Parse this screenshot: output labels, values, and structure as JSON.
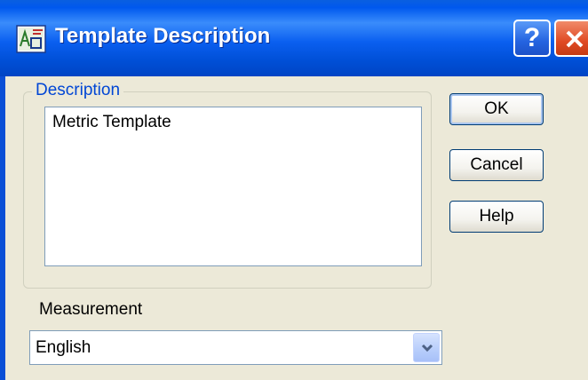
{
  "window": {
    "title": "Template Description",
    "icon": "template-app-icon",
    "help_icon": "question-mark-icon",
    "close_icon": "close-x-icon",
    "help_glyph": "?"
  },
  "description": {
    "group_label": "Description",
    "text": "Metric Template"
  },
  "buttons": {
    "ok": "OK",
    "cancel": "Cancel",
    "help": "Help"
  },
  "measurement": {
    "label": "Measurement",
    "selected": "English",
    "dropdown_icon": "chevron-down-icon"
  },
  "colors": {
    "titlebar": "#0058ee",
    "group_label": "#0046d5",
    "close_button": "#e04a24"
  }
}
